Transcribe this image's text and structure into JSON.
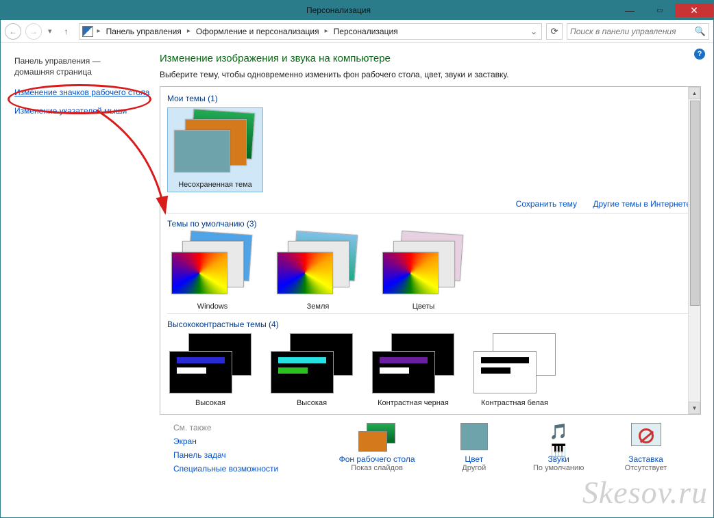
{
  "window": {
    "title": "Персонализация"
  },
  "breadcrumbs": {
    "items": [
      "Панель управления",
      "Оформление и персонализация",
      "Персонализация"
    ]
  },
  "search": {
    "placeholder": "Поиск в панели управления"
  },
  "sidebar": {
    "home1": "Панель управления —",
    "home2": "домашняя страница",
    "link_icons": "Изменение значков рабочего стола",
    "link_cursors": "Изменение указателей мыши"
  },
  "content": {
    "h1": "Изменение изображения и звука на компьютере",
    "sub": "Выберите тему, чтобы одновременно изменить фон рабочего стола, цвет, звуки и заставку.",
    "my_themes_label": "Мои темы (1)",
    "unsaved": "Несохраненная тема",
    "save_theme": "Сохранить тему",
    "more_online": "Другие темы в Интернете",
    "default_label": "Темы по умолчанию (3)",
    "defaults": {
      "t1": "Windows",
      "t2": "Земля",
      "t3": "Цветы"
    },
    "hc_label": "Высококонтрастные темы (4)",
    "hc": {
      "t1": "Высокая",
      "t2": "Высокая",
      "t3": "Контрастная черная",
      "t4": "Контрастная белая"
    }
  },
  "footer_left": {
    "header": "См. также",
    "l1": "Экран",
    "l2": "Панель задач",
    "l3": "Специальные возможности"
  },
  "footer_opts": {
    "o1": {
      "label": "Фон рабочего стола",
      "sub": "Показ слайдов"
    },
    "o2": {
      "label": "Цвет",
      "sub": "Другой"
    },
    "o3": {
      "label": "Звуки",
      "sub": "По умолчанию"
    },
    "o4": {
      "label": "Заставка",
      "sub": "Отсутствует"
    }
  },
  "watermark": "Skesov.ru"
}
